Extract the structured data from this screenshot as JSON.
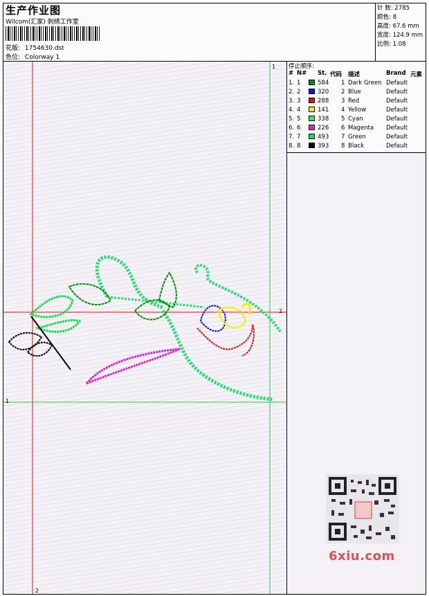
{
  "header": {
    "title": "生产作业图",
    "subtitle": "Wilcom(汇家) 刺绣工作室",
    "design_label": "花版:",
    "design_value": "1754630.dst",
    "color_label": "色位:",
    "color_value": "Colorway 1"
  },
  "info": {
    "stitches_label": "针 数:",
    "stitches": "2785",
    "colors_label": "颜色:",
    "colors": "8",
    "height_label": "高度:",
    "height": "67.6 mm",
    "width_label": "宽度:",
    "width": "124.9 mm",
    "scale_label": "比例:",
    "scale": "1.08"
  },
  "stop_table": {
    "title": "停止顺序:",
    "headers": [
      "#",
      "N#",
      "St.",
      "代码",
      "描述",
      "Brand",
      "元素"
    ],
    "rows": [
      {
        "idx": "1.",
        "n": "1",
        "color": "#009000",
        "st": "584",
        "code": "1",
        "desc": "Dark Green",
        "brand": "Default"
      },
      {
        "idx": "2.",
        "n": "2",
        "color": "#1010e0",
        "st": "320",
        "code": "2",
        "desc": "Blue",
        "brand": "Default"
      },
      {
        "idx": "3.",
        "n": "3",
        "color": "#e01010",
        "st": "288",
        "code": "3",
        "desc": "Red",
        "brand": "Default"
      },
      {
        "idx": "4.",
        "n": "4",
        "color": "#f0f000",
        "st": "141",
        "code": "4",
        "desc": "Yellow",
        "brand": "Default"
      },
      {
        "idx": "5.",
        "n": "5",
        "color": "#20f060",
        "st": "338",
        "code": "5",
        "desc": "Cyan",
        "brand": "Default"
      },
      {
        "idx": "6.",
        "n": "6",
        "color": "#e020e0",
        "st": "226",
        "code": "6",
        "desc": "Magenta",
        "brand": "Default"
      },
      {
        "idx": "7.",
        "n": "7",
        "color": "#10e050",
        "st": "493",
        "code": "7",
        "desc": "Green",
        "brand": "Default"
      },
      {
        "idx": "8.",
        "n": "8",
        "color": "#000000",
        "st": "393",
        "code": "8",
        "desc": "Black",
        "brand": "Default"
      }
    ]
  },
  "guides": {
    "v1": "1",
    "h2": "2",
    "h1": "1",
    "v2": "2"
  },
  "watermark": "6xiu.com"
}
